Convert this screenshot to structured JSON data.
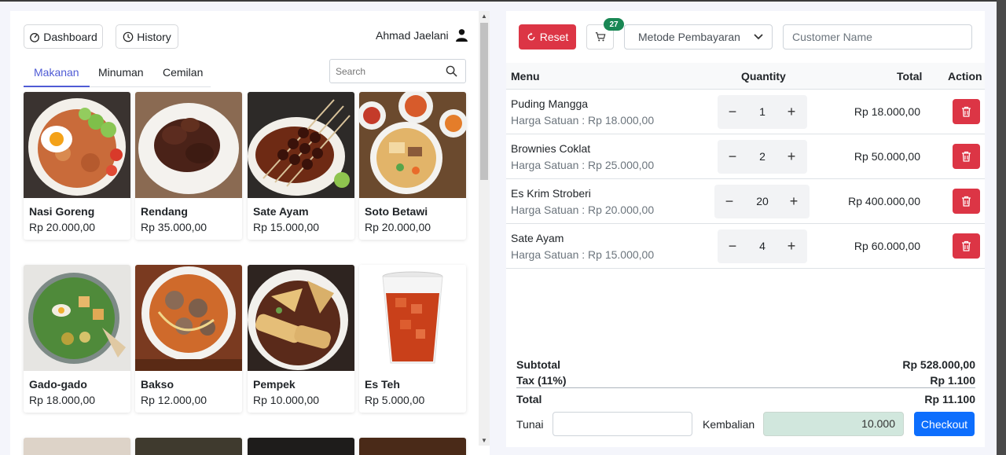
{
  "header": {
    "dashboard_label": "Dashboard",
    "history_label": "History",
    "user_name": "Ahmad Jaelani"
  },
  "tabs": [
    {
      "label": "Makanan",
      "active": true
    },
    {
      "label": "Minuman",
      "active": false
    },
    {
      "label": "Cemilan",
      "active": false
    }
  ],
  "search": {
    "placeholder": "Search"
  },
  "menu_items": [
    {
      "name": "Nasi Goreng",
      "price": "Rp 20.000,00"
    },
    {
      "name": "Rendang",
      "price": "Rp 35.000,00"
    },
    {
      "name": "Sate Ayam",
      "price": "Rp 15.000,00"
    },
    {
      "name": "Soto Betawi",
      "price": "Rp 20.000,00"
    },
    {
      "name": "Gado-gado",
      "price": "Rp 18.000,00"
    },
    {
      "name": "Bakso",
      "price": "Rp 12.000,00"
    },
    {
      "name": "Pempek",
      "price": "Rp 10.000,00"
    },
    {
      "name": "Es Teh",
      "price": "Rp 5.000,00"
    }
  ],
  "order": {
    "reset_label": "Reset",
    "cart_count": "27",
    "payment_method_placeholder": "Metode Pembayaran",
    "customer_placeholder": "Customer Name",
    "columns": {
      "menu": "Menu",
      "quantity": "Quantity",
      "total": "Total",
      "action": "Action"
    },
    "items": [
      {
        "name": "Puding Mangga",
        "unit_price": "Harga Satuan : Rp 18.000,00",
        "qty": "1",
        "total": "Rp 18.000,00"
      },
      {
        "name": "Brownies Coklat",
        "unit_price": "Harga Satuan : Rp 25.000,00",
        "qty": "2",
        "total": "Rp 50.000,00"
      },
      {
        "name": "Es Krim Stroberi",
        "unit_price": "Harga Satuan : Rp 20.000,00",
        "qty": "20",
        "total": "Rp 400.000,00"
      },
      {
        "name": "Sate Ayam",
        "unit_price": "Harga Satuan : Rp 15.000,00",
        "qty": "4",
        "total": "Rp 60.000,00"
      }
    ],
    "summary": {
      "subtotal_label": "Subtotal",
      "subtotal": "Rp 528.000,00",
      "tax_label": "Tax (11%)",
      "tax": "Rp 1.100",
      "total_label": "Total",
      "total": "Rp 11.100"
    },
    "tunai_label": "Tunai",
    "tunai_value": "",
    "kembalian_label": "Kembalian",
    "kembalian_value": "10.000",
    "checkout_label": "Checkout"
  },
  "colors": {
    "accent": "#4f5bd5",
    "danger": "#dc3545",
    "primary": "#0d6efd",
    "success": "#198754"
  }
}
